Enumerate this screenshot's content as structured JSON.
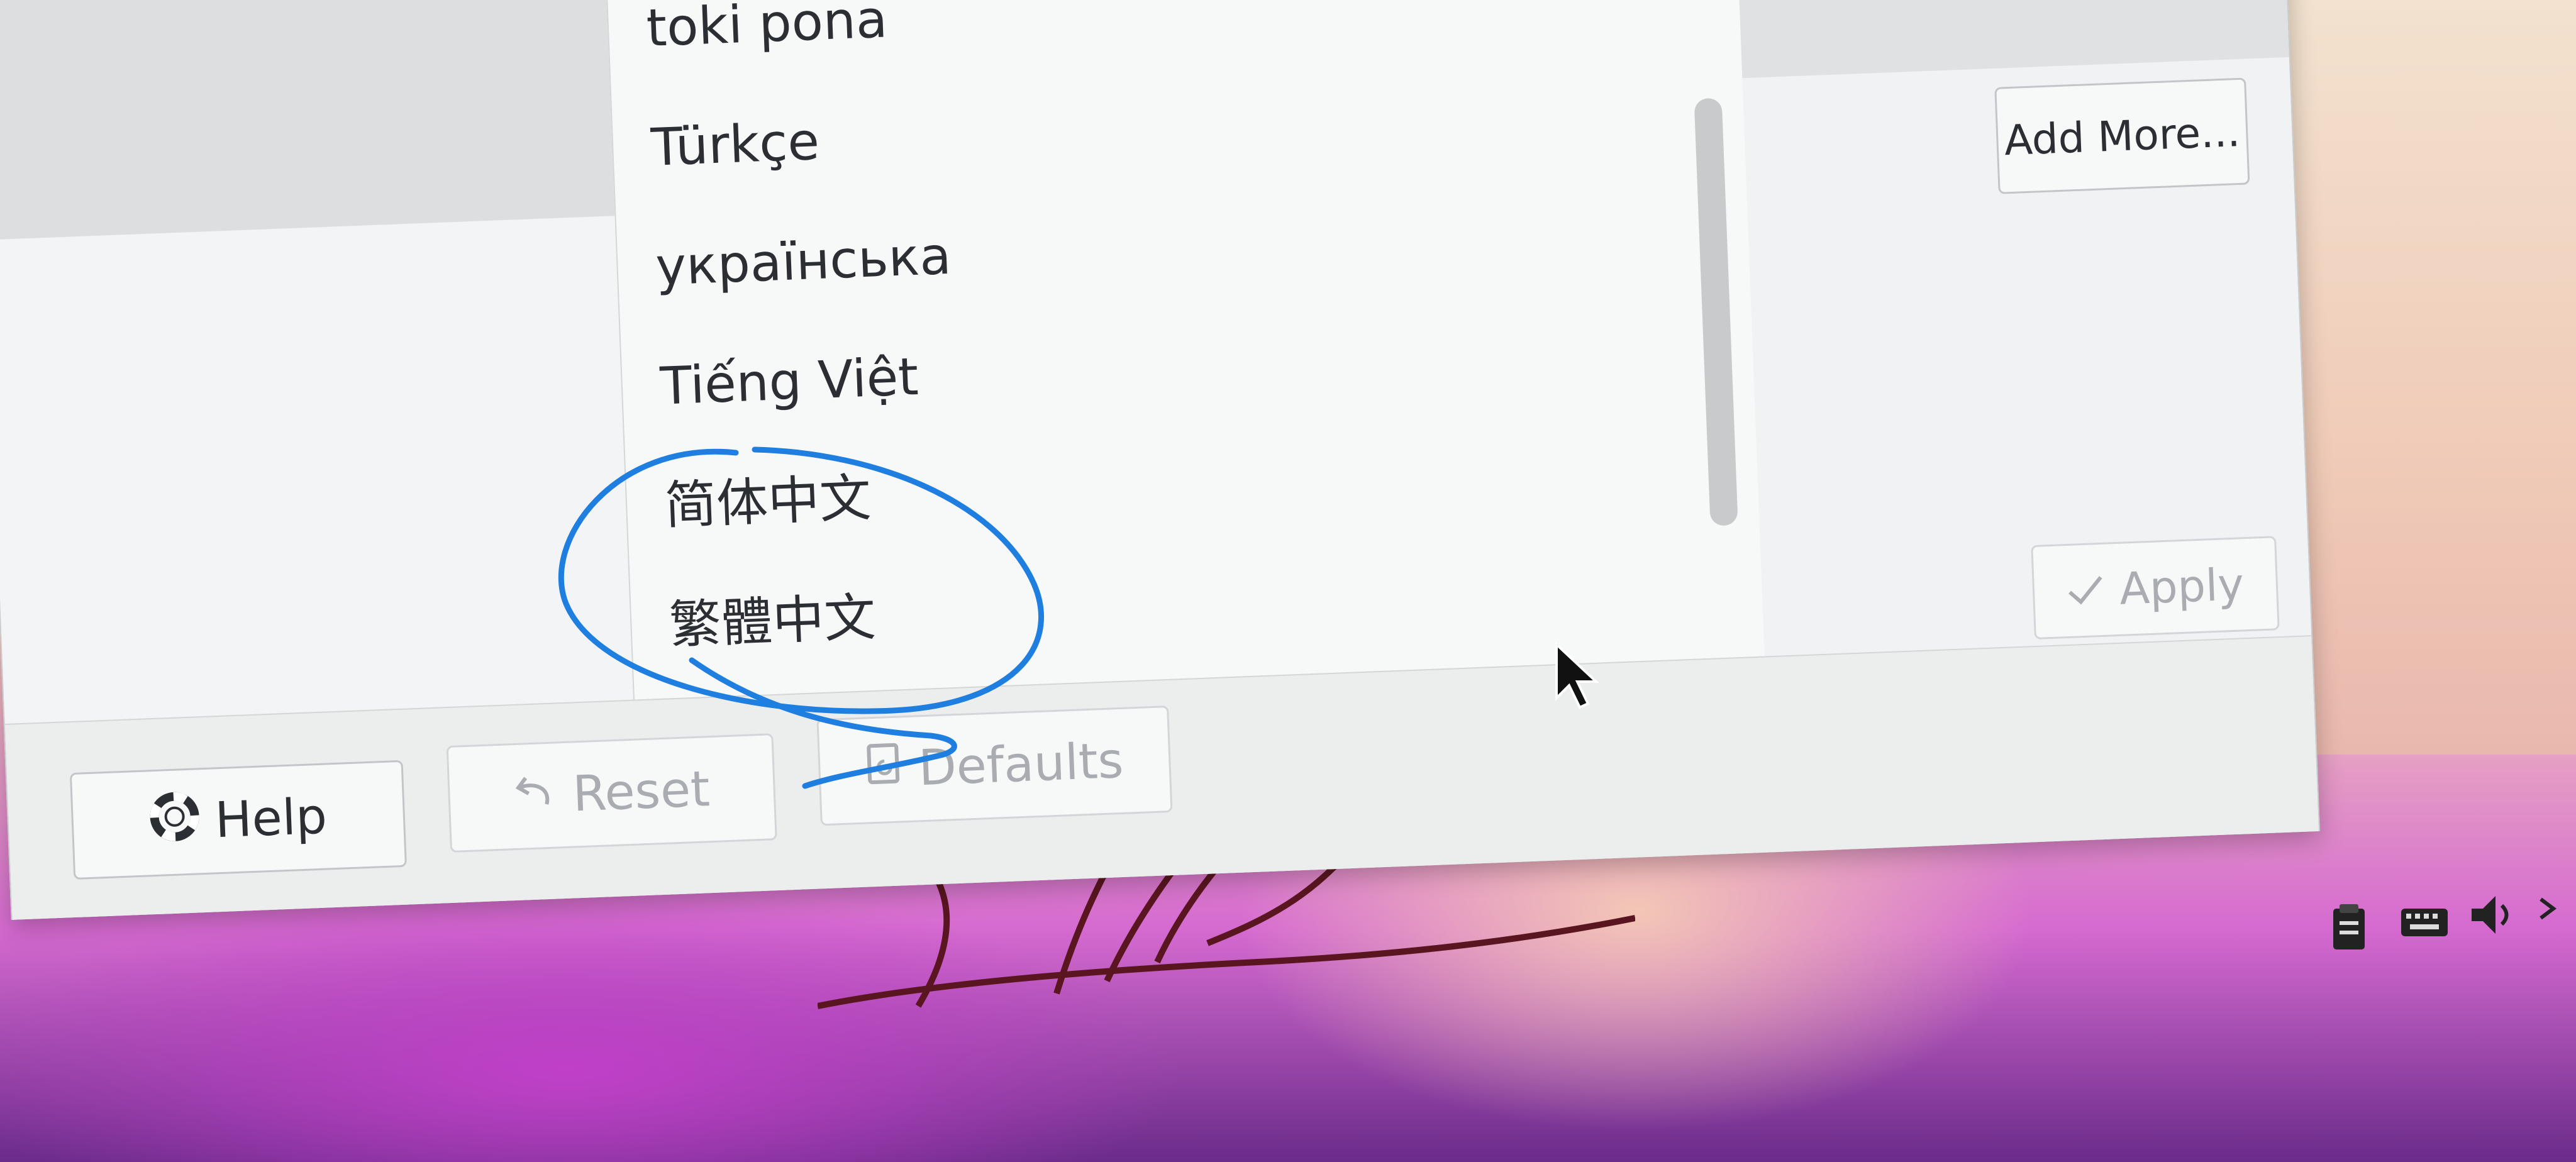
{
  "languages": {
    "items": [
      {
        "label": "toki pona"
      },
      {
        "label": "Türkçe"
      },
      {
        "label": "українська"
      },
      {
        "label": "Tiếng Việt"
      },
      {
        "label": "简体中文"
      },
      {
        "label": "繁體中文"
      }
    ]
  },
  "buttons": {
    "add_more": "Add More...",
    "apply": "Apply",
    "help": "Help",
    "reset": "Reset",
    "defaults": "Defaults"
  },
  "icons": {
    "apply": "checkmark-icon",
    "help": "lifebuoy-icon",
    "reset": "undo-icon",
    "defaults": "document-reset-icon",
    "tray": [
      "clipboard-icon",
      "keyboard-icon",
      "volume-icon",
      "expand-icon"
    ]
  },
  "annotation_color": "#1e7fe0"
}
